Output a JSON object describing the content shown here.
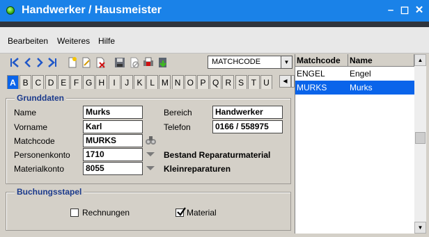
{
  "window": {
    "title": "Handwerker / Hausmeister"
  },
  "menu": [
    "Bearbeiten",
    "Weiteres",
    "Hilfe"
  ],
  "toolbar": {
    "matchcode_select": "MATCHCODE"
  },
  "letters": [
    "A",
    "B",
    "C",
    "D",
    "E",
    "F",
    "G",
    "H",
    "I",
    "J",
    "K",
    "L",
    "M",
    "N",
    "O",
    "P",
    "Q",
    "R",
    "S",
    "T",
    "U"
  ],
  "active_letter": "A",
  "grunddaten": {
    "legend": "Grunddaten",
    "name_label": "Name",
    "name_value": "Murks",
    "vorname_label": "Vorname",
    "vorname_value": "Karl",
    "matchcode_label": "Matchcode",
    "matchcode_value": "MURKS",
    "personenkonto_label": "Personenkonto",
    "personenkonto_value": "1710",
    "personenkonto_desc": "Bestand Reparaturmaterial",
    "materialkonto_label": "Materialkonto",
    "materialkonto_value": "8055",
    "materialkonto_desc": "Kleinreparaturen",
    "bereich_label": "Bereich",
    "bereich_value": "Handwerker",
    "telefon_label": "Telefon",
    "telefon_value": "0166 / 558975"
  },
  "buchungsstapel": {
    "legend": "Buchungsstapel",
    "rechnungen_label": "Rechnungen",
    "rechnungen_checked": false,
    "material_label": "Material",
    "material_checked": true
  },
  "list": {
    "columns": [
      "Matchcode",
      "Name"
    ],
    "rows": [
      {
        "matchcode": "ENGEL",
        "name": "Engel",
        "selected": false
      },
      {
        "matchcode": "MURKS",
        "name": "Murks",
        "selected": true
      }
    ]
  },
  "colors": {
    "titlebar": "#1a82e8",
    "selection": "#0a64ea",
    "legend": "#1b3a8c"
  }
}
